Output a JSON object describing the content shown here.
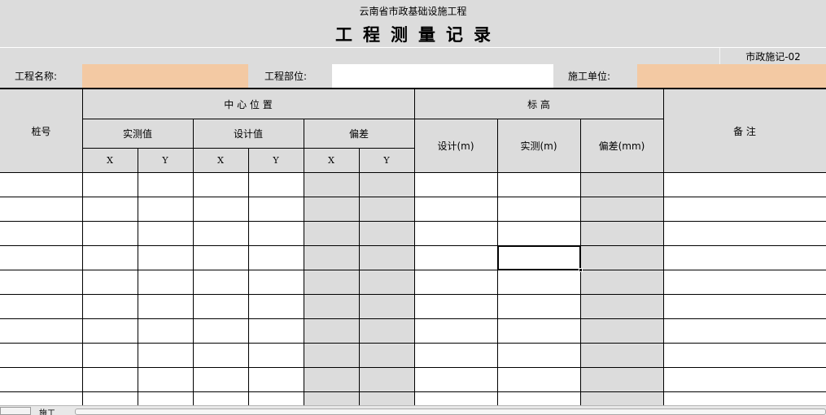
{
  "header": {
    "org": "云南省市政基础设施工程",
    "title": "工程测量记录",
    "form_code": "市政施记-02"
  },
  "info_row": {
    "project_name_label": "工程名称:",
    "project_name_value": "",
    "project_part_label": "工程部位:",
    "project_part_value": "",
    "construction_unit_label": "施工单位:",
    "construction_unit_value": ""
  },
  "table": {
    "col_pile_no": "桩号",
    "col_center_position": "中 心 位 置",
    "col_elevation": "标 高",
    "col_remarks": "备 注",
    "sub_measured": "实测值",
    "sub_design": "设计值",
    "sub_deviation": "偏差",
    "x": "X",
    "y": "Y",
    "elev_design": "设计(m)",
    "elev_measured": "实测(m)",
    "elev_deviation": "偏差(mm)",
    "row_count": 10
  },
  "sheet_tab": {
    "name": "施工"
  },
  "colors": {
    "sheet_bg": "#dcdcdc",
    "input_fill": "#f3c9a3",
    "white": "#ffffff",
    "grid_line": "#000000"
  }
}
